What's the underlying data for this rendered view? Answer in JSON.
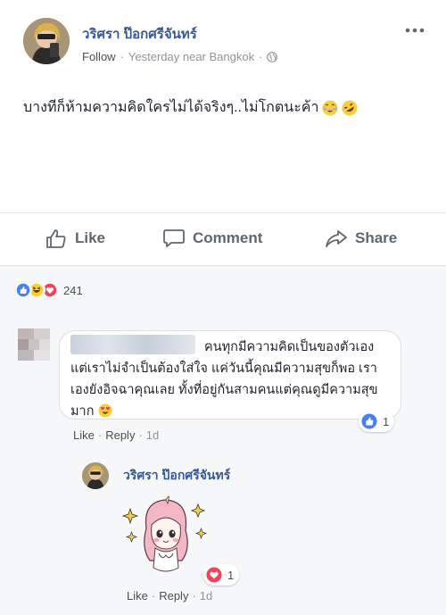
{
  "post": {
    "author": "วริศรา ป๊อกศรีจันทร์",
    "follow_label": "Follow",
    "separator": "·",
    "time_location": "Yesterday near Bangkok",
    "separator2": "·",
    "text": "บางทีก็ห้ามความคิดใครไม่ได้จริงๆ..ไม่โกตนะค้า",
    "emojis": [
      "grinning-sweat-emoji",
      "rofl-emoji"
    ]
  },
  "actions": {
    "like_label": "Like",
    "comment_label": "Comment",
    "share_label": "Share"
  },
  "reactions": {
    "icons": [
      "like-icon",
      "haha-icon",
      "love-icon"
    ],
    "count": "241",
    "colors": {
      "like": "#4a7ff1",
      "haha": "#f7d038",
      "love": "#f0435d"
    }
  },
  "comments": [
    {
      "author_blurred": true,
      "text": "คนทุกมีความคิดเป็นของตัวเอง แต่เราไม่จำเป็นต้องใส่ใจ แค่วันนี้คุณมีความสุขก็พอ เราเองยังอิจฉาคุณเลย ทั้งที่อยู่กันสามคนแต่คุณดูมีความสุขมาก",
      "emoji": "heart-eyes-emoji",
      "like_count": "1",
      "like_label": "Like",
      "reply_label": "Reply",
      "time": "1d",
      "dot": "·"
    },
    {
      "author": "วริศรา ป๊อกศรีจันทร์",
      "sticker": "unicorn-girl-sticker",
      "love_count": "1",
      "like_label": "Like",
      "reply_label": "Reply",
      "time": "1d",
      "dot": "·"
    }
  ],
  "colors": {
    "link_blue": "#365899",
    "meta_gray": "#90949c",
    "action_gray": "#606770",
    "comment_bg": "#f6f7f9"
  }
}
